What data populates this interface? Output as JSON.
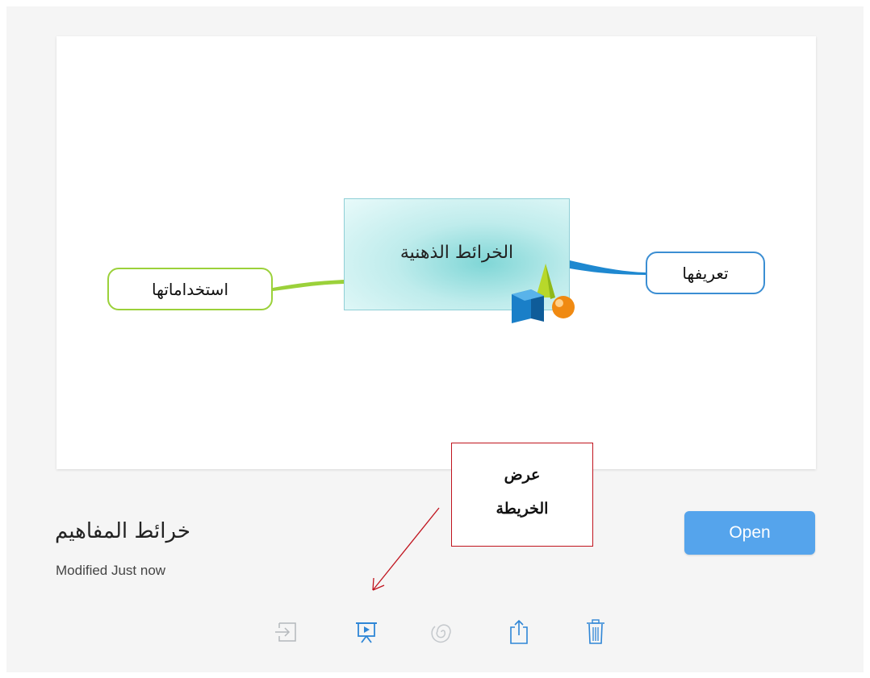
{
  "document": {
    "title": "خرائط المفاهيم",
    "modified": "Modified Just now"
  },
  "preview": {
    "central_topic": "الخرائط الذهنية",
    "left_topic": "استخداماتها",
    "right_topic": "تعريفها",
    "colors": {
      "left_branch": "#9bd13a",
      "right_branch": "#3b8ed3",
      "central_fill": "#bfecec"
    }
  },
  "annotation": {
    "line1": "عرض",
    "line2": "الخريطة",
    "color": "#c0141e"
  },
  "actions": {
    "open_label": "Open",
    "toolbar": [
      {
        "icon": "import-icon",
        "state": "disabled"
      },
      {
        "icon": "presentation-icon",
        "state": "active"
      },
      {
        "icon": "spiral-icon",
        "state": "disabled"
      },
      {
        "icon": "share-icon",
        "state": "enabled"
      },
      {
        "icon": "trash-icon",
        "state": "enabled"
      }
    ]
  }
}
